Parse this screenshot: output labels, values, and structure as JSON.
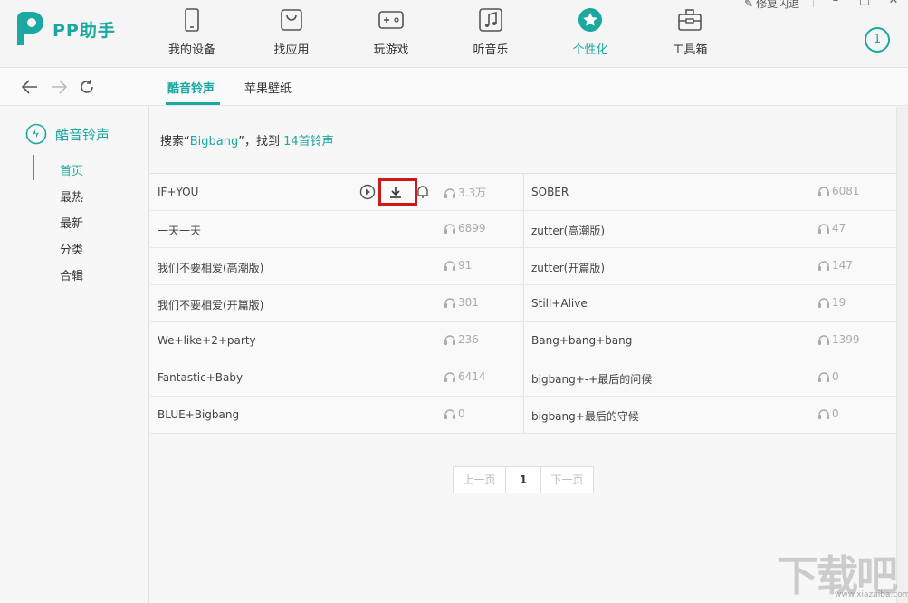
{
  "app": {
    "name": "PP助手"
  },
  "nav": [
    {
      "label": "我的设备",
      "icon": "device-icon"
    },
    {
      "label": "找应用",
      "icon": "app-bag-icon"
    },
    {
      "label": "玩游戏",
      "icon": "gamepad-icon"
    },
    {
      "label": "听音乐",
      "icon": "music-icon"
    },
    {
      "label": "个性化",
      "icon": "star-icon",
      "active": true
    },
    {
      "label": "工具箱",
      "icon": "toolbox-icon"
    }
  ],
  "header_right": {
    "repair_label": "修复闪退",
    "task_count": "1"
  },
  "subtabs": [
    {
      "label": "酷音铃声",
      "active": true
    },
    {
      "label": "苹果壁纸"
    }
  ],
  "sidebar": {
    "title": "酷音铃声",
    "items": [
      {
        "label": "首页",
        "active": true
      },
      {
        "label": "最热"
      },
      {
        "label": "最新"
      },
      {
        "label": "分类"
      },
      {
        "label": "合辑"
      }
    ]
  },
  "search": {
    "prefix": "搜索“",
    "query": "Bigbang",
    "middle": "”，找到 ",
    "result": "14首铃声"
  },
  "rows": [
    [
      {
        "name": "IF+YOU",
        "plays": "3.3万"
      },
      {
        "name": "SOBER",
        "plays": "6081"
      }
    ],
    [
      {
        "name": "一天一天",
        "plays": "6899"
      },
      {
        "name": "zutter(高潮版)",
        "plays": "47"
      }
    ],
    [
      {
        "name": "我们不要相爱(高潮版)",
        "plays": "91"
      },
      {
        "name": "zutter(开篇版)",
        "plays": "147"
      }
    ],
    [
      {
        "name": "我们不要相爱(开篇版)",
        "plays": "301"
      },
      {
        "name": "Still+Alive",
        "plays": "19"
      }
    ],
    [
      {
        "name": "We+like+2+party",
        "plays": "236"
      },
      {
        "name": "Bang+bang+bang",
        "plays": "1399"
      }
    ],
    [
      {
        "name": "Fantastic+Baby",
        "plays": "6414"
      },
      {
        "name": "bigbang+-+最后的问候",
        "plays": "0"
      }
    ],
    [
      {
        "name": "BLUE+Bigbang",
        "plays": "0"
      },
      {
        "name": "bigbang+最后的守候",
        "plays": "0"
      }
    ]
  ],
  "pager": {
    "prev": "上一页",
    "current": "1",
    "next": "下一页"
  },
  "watermark": {
    "text": "下载吧",
    "sub": "www.xiazaiba.com"
  },
  "colors": {
    "accent": "#1aa8a0",
    "highlight_box": "#cc1a1a"
  }
}
